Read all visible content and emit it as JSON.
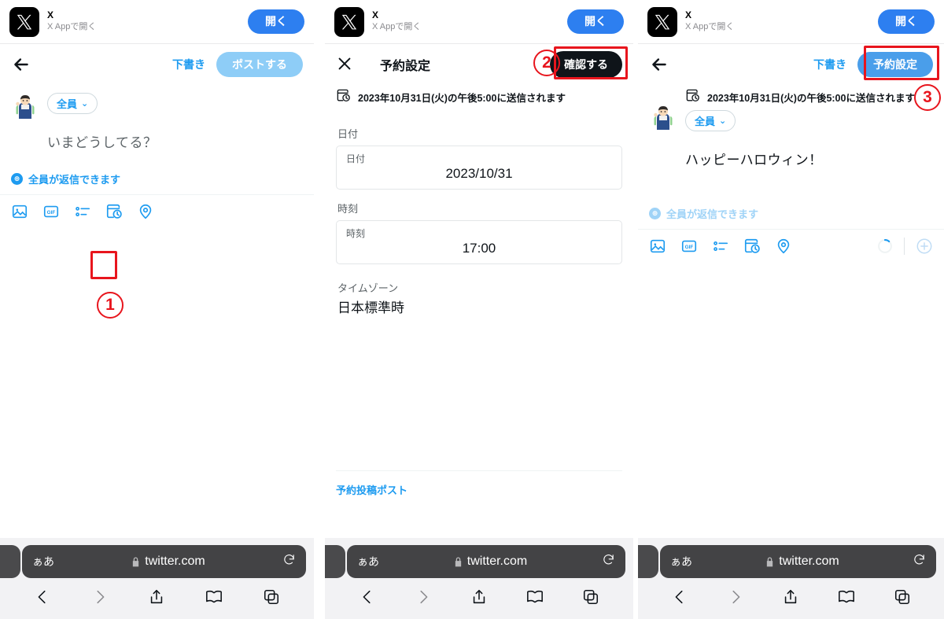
{
  "banner": {
    "app_name": "X",
    "subtitle": "X Appで開く",
    "open_label": "開く",
    "logo_icon": "x-logo-icon"
  },
  "browser": {
    "aa_label": "ぁあ",
    "url": "twitter.com",
    "lock_icon": "lock-icon",
    "reload_icon": "reload-icon",
    "back_icon": "chevron-left-icon",
    "forward_icon": "chevron-right-icon",
    "share_icon": "share-icon",
    "bookmarks_icon": "book-icon",
    "tabs_icon": "tabs-icon"
  },
  "panel1": {
    "header": {
      "back_icon": "back-arrow-icon",
      "draft_label": "下書き",
      "post_label": "ポストする"
    },
    "compose": {
      "avatar_icon": "user-avatar-icon",
      "audience_label": "全員",
      "audience_chevron_icon": "chevron-down-icon",
      "placeholder": "いまどうしてる？"
    },
    "reply_scope": {
      "globe_icon": "globe-icon",
      "label": "全員が返信できます"
    },
    "toolbar": {
      "items": [
        {
          "name": "media-icon",
          "label": "画像"
        },
        {
          "name": "gif-icon",
          "label": "GIF"
        },
        {
          "name": "poll-icon",
          "label": "アンケート"
        },
        {
          "name": "schedule-icon",
          "label": "予約設定"
        },
        {
          "name": "location-icon",
          "label": "位置情報"
        }
      ]
    }
  },
  "panel2": {
    "header": {
      "close_icon": "close-icon",
      "title": "予約設定",
      "confirm_label": "確認する"
    },
    "notice": {
      "icon": "schedule-clock-icon",
      "text": "2023年10月31日(火)の午後5:00に送信されます"
    },
    "form": {
      "date_label": "日付",
      "date_inner_label": "日付",
      "date_value": "2023/10/31",
      "time_label": "時刻",
      "time_inner_label": "時刻",
      "time_value": "17:00",
      "timezone_label": "タイムゾーン",
      "timezone_value": "日本標準時"
    },
    "footer": {
      "scheduled_posts_link": "予約投稿ポスト"
    }
  },
  "panel3": {
    "header": {
      "back_icon": "back-arrow-icon",
      "draft_label": "下書き",
      "schedule_label": "予約設定"
    },
    "notice": {
      "icon": "schedule-clock-icon",
      "text": "2023年10月31日(火)の午後5:00に送信されます"
    },
    "compose": {
      "avatar_icon": "user-avatar-icon",
      "audience_label": "全員",
      "audience_chevron_icon": "chevron-down-icon",
      "text": "ハッピーハロウィン！"
    },
    "reply_scope": {
      "globe_icon": "globe-icon",
      "label": "全員が返信できます"
    },
    "toolbar": {
      "items": [
        {
          "name": "media-icon",
          "label": "画像"
        },
        {
          "name": "gif-icon",
          "label": "GIF"
        },
        {
          "name": "poll-icon",
          "label": "アンケート"
        },
        {
          "name": "schedule-icon",
          "label": "予約設定"
        },
        {
          "name": "location-icon",
          "label": "位置情報"
        }
      ],
      "progress_icon": "character-progress-icon",
      "add_icon": "add-post-icon"
    }
  },
  "annotations": {
    "marker1": "1",
    "marker2": "2",
    "marker3": "3",
    "color": "#e8151d"
  }
}
